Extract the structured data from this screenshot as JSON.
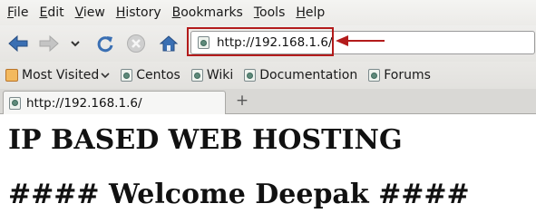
{
  "menu": [
    "File",
    "Edit",
    "View",
    "History",
    "Bookmarks",
    "Tools",
    "Help"
  ],
  "nav": {
    "back_icon": "back-arrow-icon",
    "forward_icon": "forward-arrow-icon",
    "reload_icon": "reload-icon",
    "stop_icon": "stop-icon",
    "home_icon": "home-icon"
  },
  "address_bar": {
    "url": "http://192.168.1.6/"
  },
  "bookmarks": [
    "Most Visited",
    "Centos",
    "Wiki",
    "Documentation",
    "Forums"
  ],
  "tabs": [
    {
      "label": "http://192.168.1.6/"
    }
  ],
  "new_tab_label": "+",
  "page": {
    "heading1": "IP BASED WEB HOSTING",
    "heading2": "#### Welcome Deepak ####"
  },
  "colors": {
    "highlight": "#b31b1b",
    "nav_blue": "#3a6fb3"
  }
}
